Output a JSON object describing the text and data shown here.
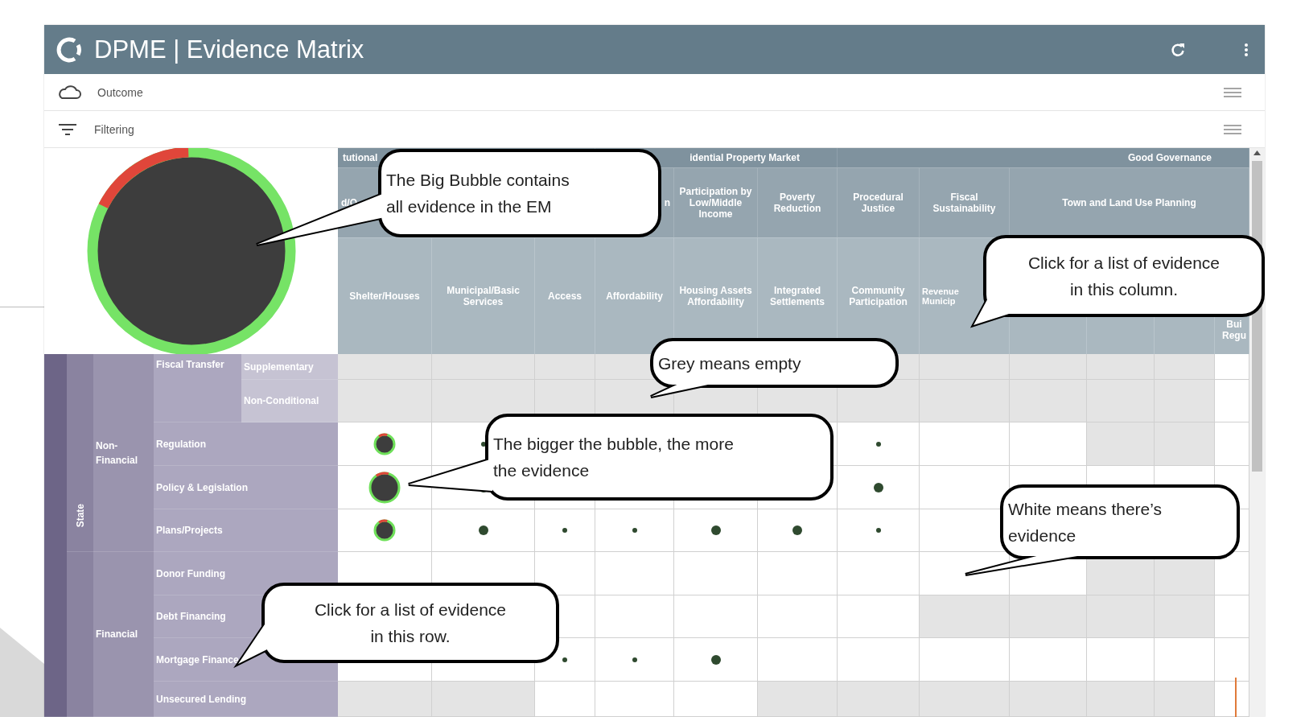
{
  "app": {
    "title": "DPME | Evidence Matrix"
  },
  "panels": [
    {
      "label": "Outcome",
      "kind": "outcome"
    },
    {
      "label": "Filtering",
      "kind": "filter"
    }
  ],
  "matrix": {
    "column_groups": [
      {
        "label": "tutional"
      },
      {
        "label": "idential Property Market"
      },
      {
        "label": "Good Governance"
      }
    ],
    "subgroups": [
      {
        "label": "d/O"
      },
      {
        "label": "n"
      },
      {
        "label": "Participation by Low/Middle Income"
      },
      {
        "label": "Poverty Reduction"
      },
      {
        "label": "Procedural Justice"
      },
      {
        "label": "Fiscal Sustainability"
      },
      {
        "label": "Town and Land Use Planning"
      }
    ],
    "columns": [
      {
        "label": "Shelter/Houses"
      },
      {
        "label": "Municipal/Basic Services"
      },
      {
        "label": "Access"
      },
      {
        "label": "Affordability"
      },
      {
        "label": "Housing Assets Affordability"
      },
      {
        "label": "Integrated Settlements"
      },
      {
        "label": "Community Participation"
      },
      {
        "label": "Revenue\nMunicip"
      },
      {},
      {},
      {},
      {
        "label": "Bui\nRegu"
      }
    ],
    "row_groups": [
      {
        "children": [
          {
            "label": "State",
            "children": [
              {
                "label": "Non-Financial",
                "children": [
                  {
                    "label": "Fiscal Transfer",
                    "children": [
                      {
                        "label": "Supplementary",
                        "cells": [
                          {
                            "evidence": false
                          },
                          {
                            "evidence": false
                          },
                          {
                            "evidence": false
                          },
                          {
                            "evidence": false
                          },
                          null,
                          null,
                          {
                            "evidence": false
                          },
                          {
                            "evidence": false
                          },
                          {
                            "evidence": false
                          },
                          {
                            "evidence": false
                          },
                          {
                            "evidence": false
                          },
                          {
                            "evidence": true
                          }
                        ]
                      },
                      {
                        "label": "Non-Conditional",
                        "cells": [
                          {
                            "evidence": false
                          },
                          {
                            "evidence": false
                          },
                          {
                            "evidence": false
                          },
                          {
                            "evidence": false
                          },
                          {
                            "evidence": false
                          },
                          {
                            "evidence": false
                          },
                          {
                            "evidence": false
                          },
                          {
                            "evidence": false
                          },
                          {
                            "evidence": false
                          },
                          {
                            "evidence": false
                          },
                          {
                            "evidence": false
                          },
                          {
                            "evidence": true
                          }
                        ]
                      }
                    ]
                  },
                  {
                    "label": "Regulation",
                    "cells": [
                      {
                        "evidence": true,
                        "kind": "medium",
                        "mixed": true
                      },
                      {
                        "evidence": true,
                        "kind": "tiny"
                      },
                      null,
                      null,
                      null,
                      {
                        "evidence": true
                      },
                      {
                        "evidence": true,
                        "kind": "tiny"
                      },
                      {
                        "evidence": true
                      },
                      {
                        "evidence": true
                      },
                      {
                        "evidence": false
                      },
                      {
                        "evidence": false
                      },
                      {
                        "evidence": true
                      }
                    ]
                  },
                  {
                    "label": "Policy & Legislation",
                    "cells": [
                      {
                        "evidence": true,
                        "kind": "large",
                        "mixed": true
                      },
                      {
                        "evidence": true,
                        "kind": "small"
                      },
                      {
                        "evidence": true
                      },
                      {
                        "evidence": true
                      },
                      {
                        "evidence": true
                      },
                      {
                        "evidence": true
                      },
                      {
                        "evidence": true,
                        "kind": "small"
                      },
                      {
                        "evidence": true
                      },
                      {
                        "evidence": true
                      },
                      {
                        "evidence": true
                      },
                      {
                        "evidence": true
                      },
                      {
                        "evidence": true
                      }
                    ]
                  },
                  {
                    "label": "Plans/Projects",
                    "cells": [
                      {
                        "evidence": true,
                        "kind": "medium",
                        "mixed": true
                      },
                      {
                        "evidence": true,
                        "kind": "small"
                      },
                      {
                        "evidence": true,
                        "kind": "tiny"
                      },
                      {
                        "evidence": true,
                        "kind": "tiny"
                      },
                      {
                        "evidence": true,
                        "kind": "small"
                      },
                      {
                        "evidence": true,
                        "kind": "small"
                      },
                      {
                        "evidence": true,
                        "kind": "tiny"
                      },
                      {
                        "evidence": true
                      },
                      null,
                      null,
                      null,
                      {
                        "evidence": true
                      }
                    ]
                  }
                ]
              }
            ]
          },
          {
            "children": [
              {
                "label": "Financial",
                "children": [
                  {
                    "label": "Donor Funding",
                    "cells": [
                      {
                        "evidence": true
                      },
                      {
                        "evidence": true
                      },
                      {
                        "evidence": true
                      },
                      {
                        "evidence": true
                      },
                      {
                        "evidence": true
                      },
                      {
                        "evidence": true
                      },
                      {
                        "evidence": true
                      },
                      {
                        "evidence": true
                      },
                      {
                        "evidence": true
                      },
                      {
                        "evidence": false
                      },
                      {
                        "evidence": false
                      },
                      {
                        "evidence": true
                      }
                    ]
                  },
                  {
                    "label": "Debt Financing",
                    "cells": [
                      null,
                      null,
                      {
                        "evidence": true
                      },
                      {
                        "evidence": true
                      },
                      {
                        "evidence": true
                      },
                      {
                        "evidence": true
                      },
                      {
                        "evidence": true
                      },
                      {
                        "evidence": false
                      },
                      {
                        "evidence": false
                      },
                      {
                        "evidence": false
                      },
                      {
                        "evidence": false
                      },
                      {
                        "evidence": true
                      }
                    ]
                  },
                  {
                    "label": "Mortgage Finance",
                    "cells": [
                      {
                        "evidence": true
                      },
                      {
                        "evidence": true
                      },
                      {
                        "evidence": true,
                        "kind": "tiny"
                      },
                      {
                        "evidence": true,
                        "kind": "tiny"
                      },
                      {
                        "evidence": true,
                        "kind": "small"
                      },
                      {
                        "evidence": true
                      },
                      {
                        "evidence": true
                      },
                      {
                        "evidence": true
                      },
                      {
                        "evidence": true
                      },
                      {
                        "evidence": true
                      },
                      {
                        "evidence": true
                      },
                      {
                        "evidence": true
                      }
                    ]
                  },
                  {
                    "label": "Unsecured Lending",
                    "cells": [
                      {
                        "evidence": false
                      },
                      {
                        "evidence": false
                      },
                      {
                        "evidence": true
                      },
                      {
                        "evidence": true
                      },
                      {
                        "evidence": true
                      },
                      {
                        "evidence": false
                      },
                      {
                        "evidence": false
                      },
                      {
                        "evidence": false
                      },
                      {
                        "evidence": false
                      },
                      {
                        "evidence": false
                      },
                      {
                        "evidence": false
                      },
                      {
                        "evidence": true
                      }
                    ]
                  }
                ]
              }
            ]
          }
        ]
      }
    ]
  },
  "callouts": [
    {
      "text": "The Big Bubble contains\nall evidence in the EM"
    },
    {
      "text": "Click for a list of evidence\nin this column."
    },
    {
      "text": "Grey means empty"
    },
    {
      "text": "The bigger the bubble, the more\nthe evidence"
    },
    {
      "text": "White means there’s\nevidence"
    },
    {
      "text": "Click for a list of evidence\nin this row."
    }
  ]
}
